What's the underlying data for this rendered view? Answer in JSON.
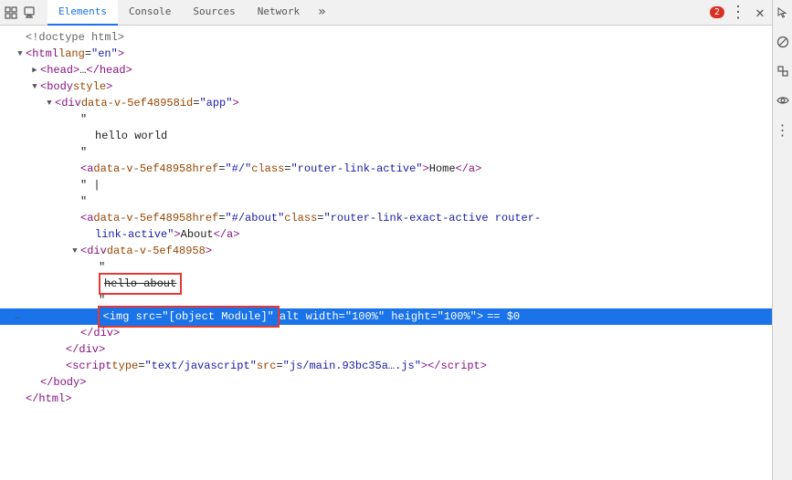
{
  "tabs": [
    {
      "label": "Elements",
      "active": true
    },
    {
      "label": "Console",
      "active": false
    },
    {
      "label": "Sources",
      "active": false
    },
    {
      "label": "Network",
      "active": false
    }
  ],
  "error_count": "2",
  "dom": {
    "lines": [
      {
        "id": "line1",
        "indent": 0,
        "triangle": "empty",
        "content": "doctype",
        "text": "<!doctype html>"
      },
      {
        "id": "line2",
        "indent": 0,
        "triangle": "expanded",
        "content": "tag",
        "tag": "html",
        "attrs": [
          {
            "name": "lang",
            "value": "\"en\""
          }
        ],
        "closing": false
      },
      {
        "id": "line3",
        "indent": 1,
        "triangle": "collapsed",
        "content": "tag",
        "tag": "head",
        "text": "…</head>"
      },
      {
        "id": "line4",
        "indent": 1,
        "triangle": "expanded",
        "content": "tag",
        "tag": "body",
        "attrs": [
          {
            "name": "style",
            "value": ""
          }
        ],
        "closing": false
      },
      {
        "id": "line5",
        "indent": 2,
        "triangle": "expanded",
        "content": "tag",
        "tag": "div",
        "attrs": [
          {
            "name": "data-v-5ef48958",
            "value": ""
          },
          {
            "name": "id",
            "value": "\"app\""
          }
        ],
        "closing": false
      },
      {
        "id": "line6",
        "indent": 3,
        "triangle": "empty",
        "content": "text",
        "text": "\""
      },
      {
        "id": "line7",
        "indent": 4,
        "triangle": "empty",
        "content": "text",
        "text": "hello world"
      },
      {
        "id": "line8",
        "indent": 3,
        "triangle": "empty",
        "content": "text",
        "text": "\""
      },
      {
        "id": "line9",
        "indent": 3,
        "triangle": "empty",
        "content": "tag_inline",
        "tag": "a",
        "attrs": [
          {
            "name": "data-v-5ef48958",
            "value": ""
          },
          {
            "name": "href",
            "value": "\"#/\""
          },
          {
            "name": "class",
            "value": "\"router-link-active\""
          }
        ],
        "inner": "Home"
      },
      {
        "id": "line10",
        "indent": 3,
        "triangle": "empty",
        "content": "text",
        "text": "\" |"
      },
      {
        "id": "line11",
        "indent": 3,
        "triangle": "empty",
        "content": "text",
        "text": "\""
      },
      {
        "id": "line12",
        "indent": 3,
        "triangle": "empty",
        "content": "tag_inline_long",
        "tag": "a",
        "attrs": [
          {
            "name": "data-v-5ef48958",
            "value": ""
          },
          {
            "name": "href",
            "value": "\"#/about\""
          },
          {
            "name": "class",
            "value": "\"router-link-exact-active router-"
          }
        ],
        "inner": "About",
        "wrap": true
      },
      {
        "id": "line12b",
        "indent": 4,
        "triangle": "empty",
        "content": "text_continuation",
        "text": "link-active\">About</a>"
      },
      {
        "id": "line13",
        "indent": 3,
        "triangle": "expanded",
        "content": "tag",
        "tag": "div",
        "attrs": [
          {
            "name": "data-v-5ef48958",
            "value": ""
          }
        ],
        "closing": false
      },
      {
        "id": "line14",
        "indent": 4,
        "triangle": "empty",
        "content": "text",
        "text": "\""
      },
      {
        "id": "line15",
        "indent": 4,
        "triangle": "empty",
        "content": "strikethrough",
        "text": "hello about"
      },
      {
        "id": "line16",
        "indent": 4,
        "triangle": "empty",
        "content": "text",
        "text": "\""
      },
      {
        "id": "line17",
        "indent": 4,
        "triangle": "empty",
        "content": "selected_img",
        "text": "<img src=\"[object Module]\" alt width=\"100%\" height=\"100%\"> == $0",
        "selected": true
      },
      {
        "id": "line18",
        "indent": 3,
        "triangle": "empty",
        "content": "close_tag",
        "tag": "div"
      },
      {
        "id": "line19",
        "indent": 2,
        "triangle": "empty",
        "content": "close_tag",
        "tag": "div"
      },
      {
        "id": "line20",
        "indent": 2,
        "triangle": "empty",
        "content": "tag_inline",
        "tag": "script",
        "attrs": [
          {
            "name": "type",
            "value": "\"text/javascript\""
          },
          {
            "name": "src",
            "value": "\"js/main.93bc35a….js\""
          }
        ],
        "inner": ""
      },
      {
        "id": "line21",
        "indent": 1,
        "triangle": "empty",
        "content": "close_tag",
        "tag": "body"
      },
      {
        "id": "line22",
        "indent": 0,
        "triangle": "empty",
        "content": "close_tag",
        "tag": "html"
      }
    ]
  },
  "sidebar_icons": [
    "cursor",
    "phone",
    "layers",
    "eye",
    "more"
  ]
}
